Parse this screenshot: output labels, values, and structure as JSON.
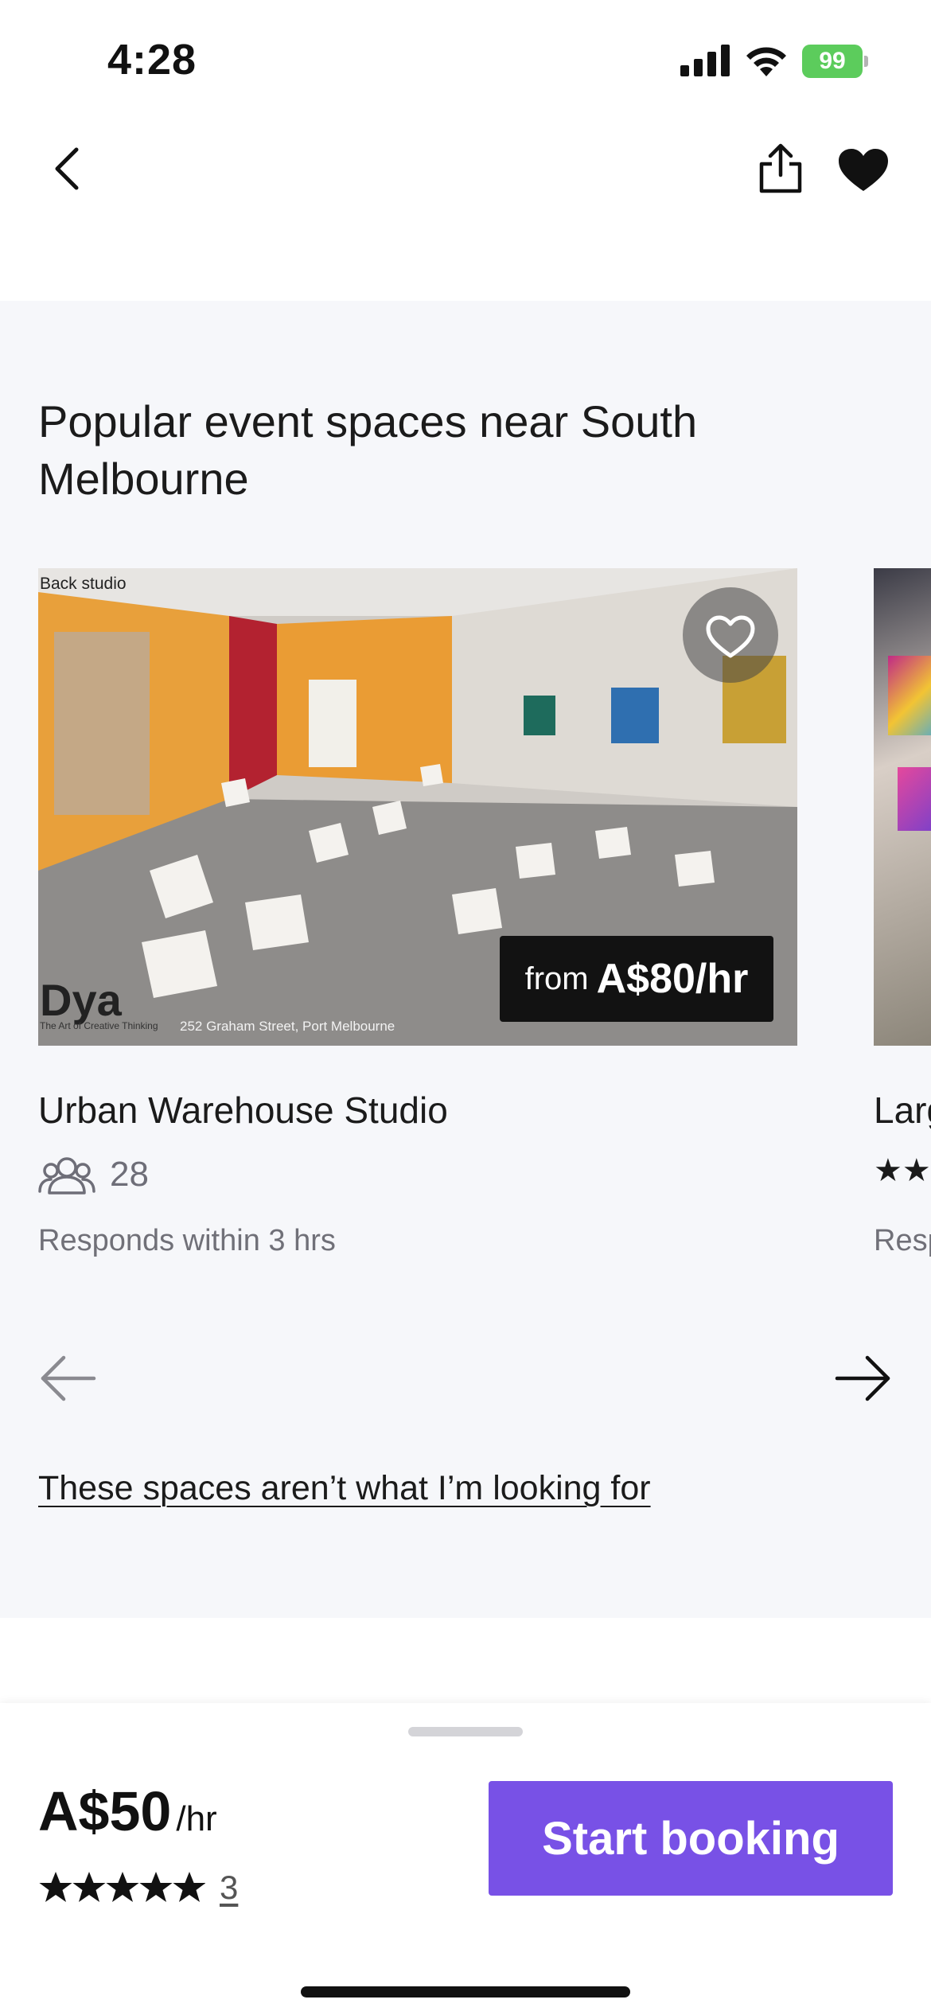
{
  "status": {
    "time": "4:28",
    "battery": "99"
  },
  "nav": {
    "back_icon": "chevron-left-icon",
    "share_icon": "share-icon",
    "favorite_icon": "heart-filled-icon"
  },
  "section": {
    "title": "Popular event spaces near South Melbourne",
    "cards": [
      {
        "image_label": "Back studio",
        "image_logo": "Dya",
        "image_tagline": "The Art of Creative Thinking",
        "image_address": "252 Graham Street, Port Melbourne",
        "price_prefix": "from",
        "price": "A$80/hr",
        "name": "Urban Warehouse Studio",
        "capacity": "28",
        "responds": "Responds within 3 hrs"
      },
      {
        "name": "Larg",
        "stars": "★★",
        "responds": "Resp"
      }
    ],
    "not_looking_link": "These spaces aren’t what I’m looking for"
  },
  "bottom_bar": {
    "price": "A$50",
    "price_unit": "/hr",
    "rating_stars": 5,
    "review_count": "3",
    "cta_label": "Start booking",
    "cta_color": "#7851e6"
  }
}
